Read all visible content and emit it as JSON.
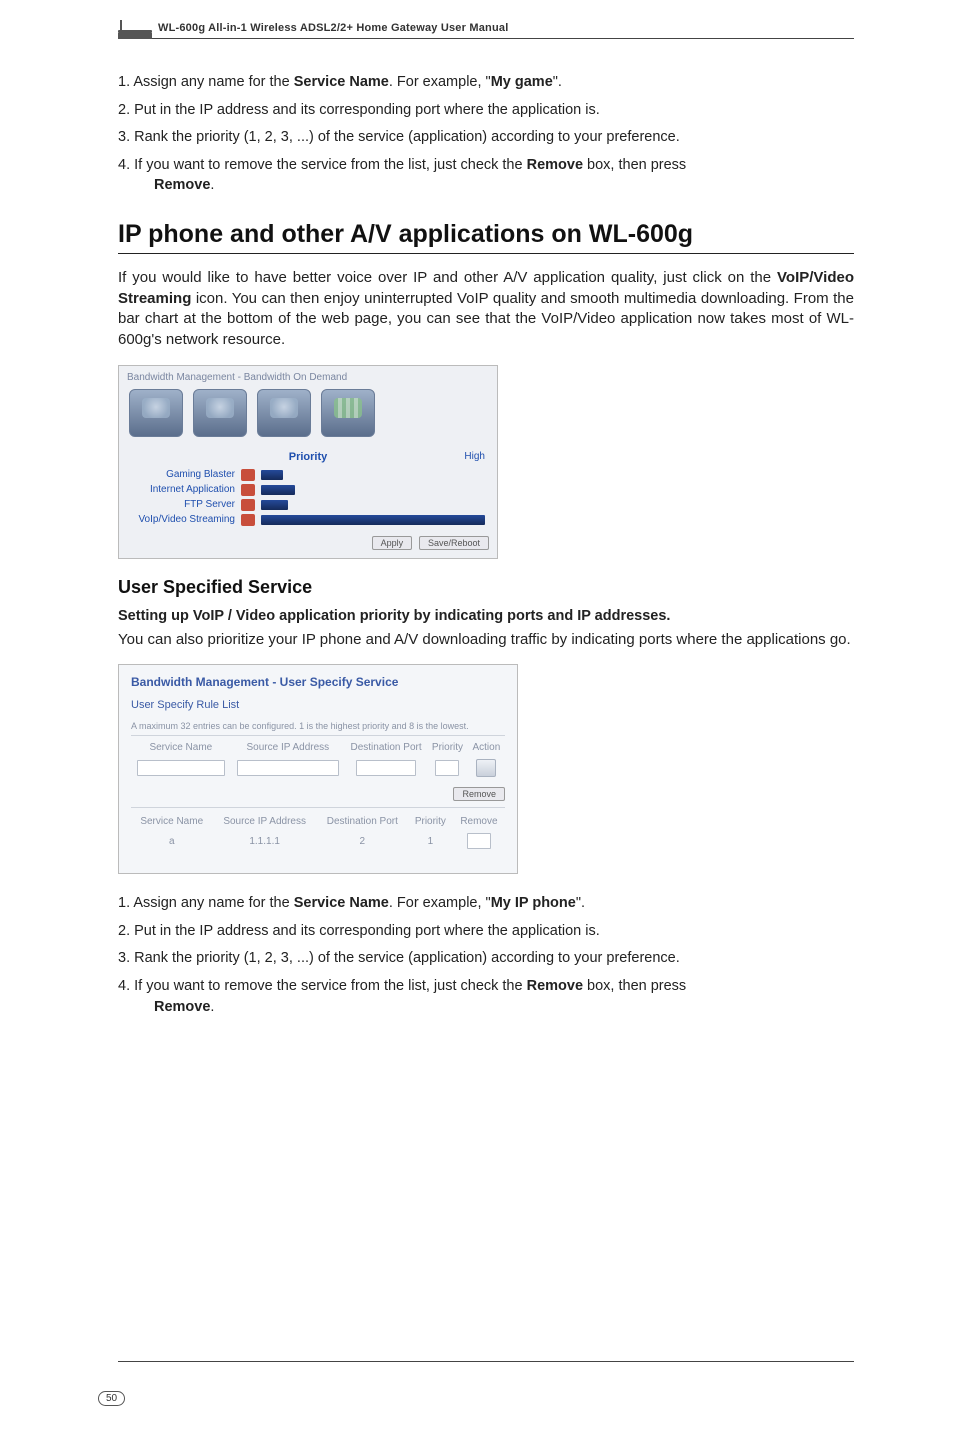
{
  "header": {
    "manualTitle": "WL-600g All-in-1 Wireless ADSL2/2+ Home Gateway User Manual"
  },
  "stepsTop": [
    {
      "prefix": "1. ",
      "html": "Assign any name for the <b>Service Name</b>. For example, \"<b>My game</b>\"."
    },
    {
      "prefix": "2. ",
      "html": "Put in the IP address and its corresponding port where the application is."
    },
    {
      "prefix": "3. ",
      "html": "Rank the priority (1, 2, 3, ...) of the service (application) according to your preference."
    },
    {
      "prefix": "4. ",
      "html": "If you want to remove the service from the list, just check the <b>Remove</b> box, then press",
      "cont": "<b>Remove</b>."
    }
  ],
  "section": {
    "title": "IP phone and other A/V applications on WL-600g",
    "para": "If you would like to have better voice over IP and other A/V application quality, just click on the <b>VoIP/Video Streaming</b> icon. You can then enjoy uninterrupted VoIP quality and smooth multimedia downloading. From the bar chart at the bottom of the web page, you can see that the VoIP/Video application now takes most of WL-600g's network resource."
  },
  "fig1": {
    "caption": "Bandwidth Management - Bandwidth On Demand",
    "priorityLabel": "Priority",
    "highLabel": "High",
    "applyLabel": "Apply",
    "saveLabel": "Save/Reboot",
    "bars": [
      {
        "label": "Gaming Blaster",
        "pct": 10
      },
      {
        "label": "Internet Application",
        "pct": 15
      },
      {
        "label": "FTP Server",
        "pct": 12
      },
      {
        "label": "VoIp/Video Streaming",
        "pct": 100
      }
    ]
  },
  "subsection": {
    "title": "User Specified Service",
    "boldLine": "Setting up VoIP / Video application priority by indicating ports and IP addresses.",
    "para": "You can also prioritize your IP phone and A/V downloading traffic by indicating ports where the applications go."
  },
  "fig2": {
    "title1": "Bandwidth Management - User Specify Service",
    "title2": "User Specify Rule List",
    "hint": "A maximum 32 entries can be configured. 1 is the highest priority and 8 is the lowest.",
    "headers1": [
      "Service Name",
      "Source IP Address",
      "Destination Port",
      "Priority",
      "Action"
    ],
    "headers2": [
      "Service Name",
      "Source IP Address",
      "Destination Port",
      "Priority",
      "Remove"
    ],
    "row2": {
      "name": "a",
      "src": "1.1.1.1",
      "dst": "2",
      "pri": "1"
    },
    "removeBtn": "Remove"
  },
  "stepsBottom": [
    {
      "prefix": "1. ",
      "html": "Assign any name for the <b>Service Name</b>. For example, \"<b>My IP phone</b>\"."
    },
    {
      "prefix": "2. ",
      "html": "Put in the IP address and its corresponding port where the application is."
    },
    {
      "prefix": "3. ",
      "html": "Rank the priority (1, 2, 3, ...) of the service (application) according to your preference."
    },
    {
      "prefix": "4. ",
      "html": "If you want to remove the service from the list, just check the <b>Remove</b> box, then press",
      "cont": "<b>Remove</b>."
    }
  ],
  "pageNumber": "50",
  "chart_data": {
    "type": "bar",
    "title": "Priority",
    "categories": [
      "Gaming Blaster",
      "Internet Application",
      "FTP Server",
      "VoIp/Video Streaming"
    ],
    "values": [
      10,
      15,
      12,
      100
    ],
    "xlabel": "",
    "ylabel": "Priority",
    "ylim": [
      0,
      100
    ]
  }
}
